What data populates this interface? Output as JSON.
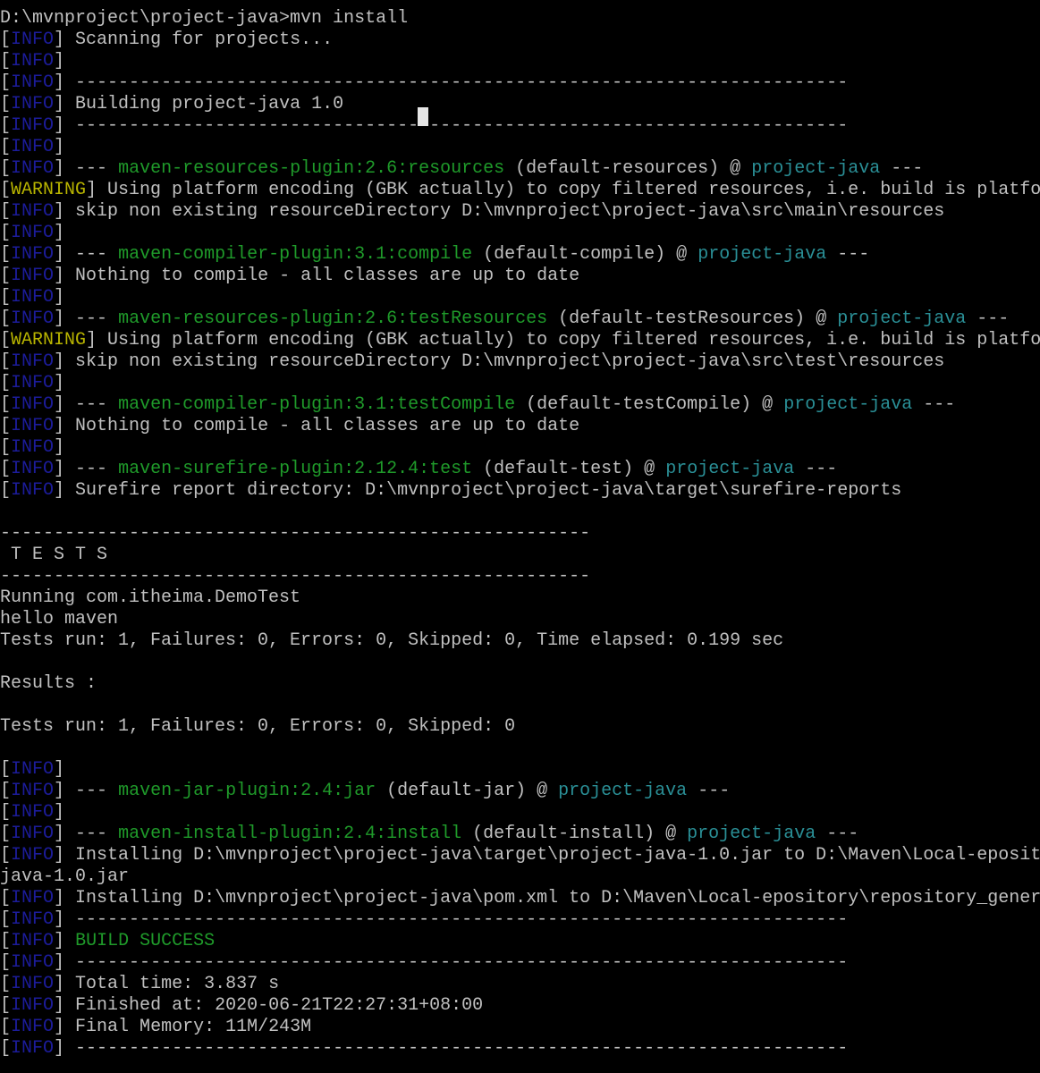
{
  "terminal": {
    "colors": {
      "background": "#000000",
      "text": "#c0c0c0",
      "info_tag": "#1c1c9a",
      "warning_tag": "#b8b400",
      "plugin": "#1f9a2a",
      "project": "#2a8f96",
      "success": "#1f9a2a"
    },
    "lines": [
      {
        "segs": [
          {
            "t": "D:\\mvnproject\\project-java>mvn install"
          }
        ]
      },
      {
        "tag": "INFO",
        "segs": [
          {
            "t": " Scanning for projects..."
          }
        ]
      },
      {
        "tag": "INFO",
        "segs": []
      },
      {
        "tag": "INFO",
        "segs": [
          {
            "t": " ------------------------------------------------------------------------"
          }
        ]
      },
      {
        "tag": "INFO",
        "segs": [
          {
            "t": " Building project-java 1.0"
          }
        ]
      },
      {
        "tag": "INFO",
        "segs": [
          {
            "t": " ------------------------------------------------------------------------"
          }
        ]
      },
      {
        "tag": "INFO",
        "segs": []
      },
      {
        "tag": "INFO",
        "segs": [
          {
            "t": " --- "
          },
          {
            "t": "maven-resources-plugin:2.6:resources",
            "c": "green"
          },
          {
            "t": " (default-resources) @ "
          },
          {
            "t": "project-java",
            "c": "cyan"
          },
          {
            "t": " ---"
          }
        ]
      },
      {
        "tag": "WARNING",
        "segs": [
          {
            "t": " Using platform encoding (GBK actually) to copy filtered resources, i.e. build is platfo"
          }
        ]
      },
      {
        "tag": "INFO",
        "segs": [
          {
            "t": " skip non existing resourceDirectory D:\\mvnproject\\project-java\\src\\main\\resources"
          }
        ]
      },
      {
        "tag": "INFO",
        "segs": []
      },
      {
        "tag": "INFO",
        "segs": [
          {
            "t": " --- "
          },
          {
            "t": "maven-compiler-plugin:3.1:compile",
            "c": "green"
          },
          {
            "t": " (default-compile) @ "
          },
          {
            "t": "project-java",
            "c": "cyan"
          },
          {
            "t": " ---"
          }
        ]
      },
      {
        "tag": "INFO",
        "segs": [
          {
            "t": " Nothing to compile - all classes are up to date"
          }
        ]
      },
      {
        "tag": "INFO",
        "segs": []
      },
      {
        "tag": "INFO",
        "segs": [
          {
            "t": " --- "
          },
          {
            "t": "maven-resources-plugin:2.6:testResources",
            "c": "green"
          },
          {
            "t": " (default-testResources) @ "
          },
          {
            "t": "project-java",
            "c": "cyan"
          },
          {
            "t": " ---"
          }
        ]
      },
      {
        "tag": "WARNING",
        "segs": [
          {
            "t": " Using platform encoding (GBK actually) to copy filtered resources, i.e. build is platfo"
          }
        ]
      },
      {
        "tag": "INFO",
        "segs": [
          {
            "t": " skip non existing resourceDirectory D:\\mvnproject\\project-java\\src\\test\\resources"
          }
        ]
      },
      {
        "tag": "INFO",
        "segs": []
      },
      {
        "tag": "INFO",
        "segs": [
          {
            "t": " --- "
          },
          {
            "t": "maven-compiler-plugin:3.1:testCompile",
            "c": "green"
          },
          {
            "t": " (default-testCompile) @ "
          },
          {
            "t": "project-java",
            "c": "cyan"
          },
          {
            "t": " ---"
          }
        ]
      },
      {
        "tag": "INFO",
        "segs": [
          {
            "t": " Nothing to compile - all classes are up to date"
          }
        ]
      },
      {
        "tag": "INFO",
        "segs": []
      },
      {
        "tag": "INFO",
        "segs": [
          {
            "t": " --- "
          },
          {
            "t": "maven-surefire-plugin:2.12.4:test",
            "c": "green"
          },
          {
            "t": " (default-test) @ "
          },
          {
            "t": "project-java",
            "c": "cyan"
          },
          {
            "t": " ---"
          }
        ]
      },
      {
        "tag": "INFO",
        "segs": [
          {
            "t": " Surefire report directory: D:\\mvnproject\\project-java\\target\\surefire-reports"
          }
        ]
      },
      {
        "segs": []
      },
      {
        "segs": [
          {
            "t": "-------------------------------------------------------"
          }
        ]
      },
      {
        "segs": [
          {
            "t": " T E S T S"
          }
        ]
      },
      {
        "segs": [
          {
            "t": "-------------------------------------------------------"
          }
        ]
      },
      {
        "segs": [
          {
            "t": "Running com.itheima.DemoTest"
          }
        ]
      },
      {
        "segs": [
          {
            "t": "hello maven"
          }
        ]
      },
      {
        "segs": [
          {
            "t": "Tests run: 1, Failures: 0, Errors: 0, Skipped: 0, Time elapsed: 0.199 sec"
          }
        ]
      },
      {
        "segs": []
      },
      {
        "segs": [
          {
            "t": "Results :"
          }
        ]
      },
      {
        "segs": []
      },
      {
        "segs": [
          {
            "t": "Tests run: 1, Failures: 0, Errors: 0, Skipped: 0"
          }
        ]
      },
      {
        "segs": []
      },
      {
        "tag": "INFO",
        "segs": []
      },
      {
        "tag": "INFO",
        "segs": [
          {
            "t": " --- "
          },
          {
            "t": "maven-jar-plugin:2.4:jar",
            "c": "green"
          },
          {
            "t": " (default-jar) @ "
          },
          {
            "t": "project-java",
            "c": "cyan"
          },
          {
            "t": " ---"
          }
        ]
      },
      {
        "tag": "INFO",
        "segs": []
      },
      {
        "tag": "INFO",
        "segs": [
          {
            "t": " --- "
          },
          {
            "t": "maven-install-plugin:2.4:install",
            "c": "green"
          },
          {
            "t": " (default-install) @ "
          },
          {
            "t": "project-java",
            "c": "cyan"
          },
          {
            "t": " ---"
          }
        ]
      },
      {
        "tag": "INFO",
        "segs": [
          {
            "t": " Installing D:\\mvnproject\\project-java\\target\\project-java-1.0.jar to D:\\Maven\\Local-eposit"
          }
        ]
      },
      {
        "segs": [
          {
            "t": "java-1.0.jar"
          }
        ]
      },
      {
        "tag": "INFO",
        "segs": [
          {
            "t": " Installing D:\\mvnproject\\project-java\\pom.xml to D:\\Maven\\Local-epository\\repository_gener"
          }
        ]
      },
      {
        "tag": "INFO",
        "segs": [
          {
            "t": " ------------------------------------------------------------------------"
          }
        ]
      },
      {
        "tag": "INFO",
        "segs": [
          {
            "t": " "
          },
          {
            "t": "BUILD SUCCESS",
            "c": "green"
          }
        ]
      },
      {
        "tag": "INFO",
        "segs": [
          {
            "t": " ------------------------------------------------------------------------"
          }
        ]
      },
      {
        "tag": "INFO",
        "segs": [
          {
            "t": " Total time: 3.837 s"
          }
        ]
      },
      {
        "tag": "INFO",
        "segs": [
          {
            "t": " Finished at: 2020-06-21T22:27:31+08:00"
          }
        ]
      },
      {
        "tag": "INFO",
        "segs": [
          {
            "t": " Final Memory: 11M/243M"
          }
        ]
      },
      {
        "tag": "INFO",
        "segs": [
          {
            "t": " ------------------------------------------------------------------------"
          }
        ]
      }
    ]
  }
}
